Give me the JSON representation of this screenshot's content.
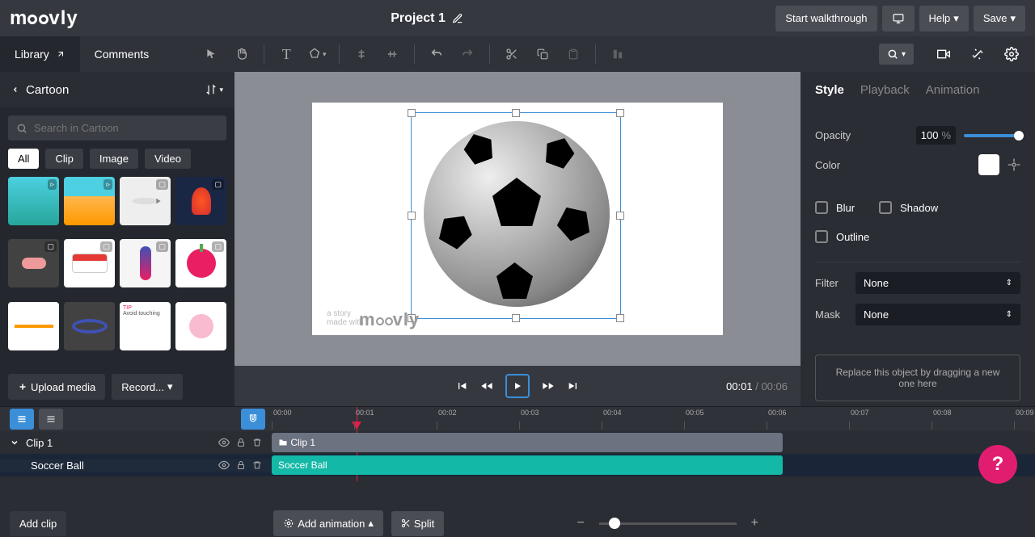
{
  "app": {
    "logo_text": "moovly"
  },
  "project": {
    "title": "Project 1"
  },
  "topbar": {
    "walkthrough": "Start walkthrough",
    "help": "Help",
    "save": "Save"
  },
  "tabs": {
    "library": "Library",
    "comments": "Comments"
  },
  "library": {
    "category": "Cartoon",
    "search_placeholder": "Search in Cartoon",
    "filters": {
      "all": "All",
      "clip": "Clip",
      "image": "Image",
      "video": "Video"
    },
    "upload": "Upload media",
    "record": "Record..."
  },
  "playback": {
    "current": "00:01",
    "total": "00:06"
  },
  "style_panel": {
    "tabs": {
      "style": "Style",
      "playback": "Playback",
      "animation": "Animation"
    },
    "opacity_label": "Opacity",
    "opacity_value": "100",
    "opacity_unit": "%",
    "color_label": "Color",
    "blur": "Blur",
    "shadow": "Shadow",
    "outline": "Outline",
    "filter_label": "Filter",
    "filter_value": "None",
    "mask_label": "Mask",
    "mask_value": "None",
    "dropzone": "Replace this object by dragging a new one here"
  },
  "timeline": {
    "ticks": [
      "00:00",
      "00:01",
      "00:02",
      "00:03",
      "00:04",
      "00:05",
      "00:06",
      "00:07",
      "00:08",
      "00:09"
    ],
    "clip_name": "Clip 1",
    "item_name": "Soccer Ball",
    "add_clip": "Add clip",
    "add_animation": "Add animation",
    "split": "Split"
  }
}
